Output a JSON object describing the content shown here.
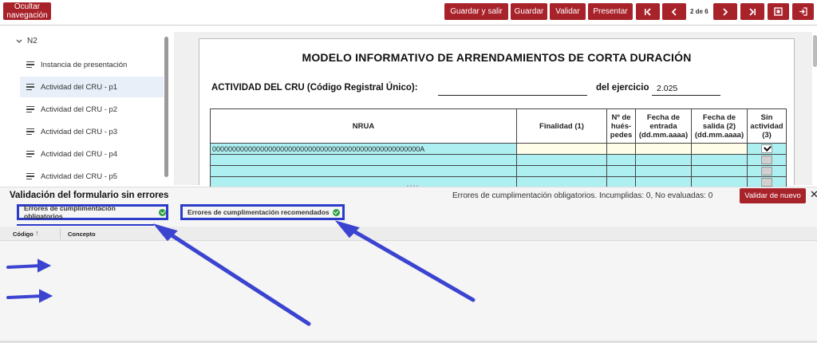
{
  "nav_toggle": {
    "label": "Ocultar navegación"
  },
  "toolbar": {
    "guardar_salir": "Guardar y salir",
    "guardar": "Guardar",
    "validar": "Validar",
    "presentar": "Presentar",
    "first_icon": "first-page-icon",
    "prev_icon": "previous-page-icon",
    "page_indicator": "2 de 6",
    "next_icon": "next-page-icon",
    "last_icon": "last-page-icon",
    "fit_icon": "fit-screen-icon",
    "exit_icon": "exit-icon"
  },
  "sidebar": {
    "root": "N2",
    "items": [
      {
        "label": "Instancia de presentación"
      },
      {
        "label": "Actividad del CRU - p1"
      },
      {
        "label": "Actividad del CRU - p2"
      },
      {
        "label": "Actividad del CRU - p3"
      },
      {
        "label": "Actividad del CRU - p4"
      },
      {
        "label": "Actividad del CRU - p5"
      }
    ],
    "active_index": 1
  },
  "document": {
    "title": "MODELO INFORMATIVO DE ARRENDAMIENTOS DE CORTA DURACIÓN",
    "cru_label": "ACTIVIDAD DEL CRU (Código Registral Único):",
    "ejercicio_label": "del ejercicio",
    "ejercicio_value": "2.025",
    "table": {
      "headers": {
        "nrua": "NRUA",
        "finalidad": "Finalidad (1)",
        "huespedes": "Nº de hués-pedes",
        "fecha_entrada": "Fecha de entrada (dd.mm.aaaa)",
        "fecha_salida": "Fecha de salida (2) (dd.mm.aaaa)",
        "sin_actividad": "Sin actividad (3)"
      },
      "rows": [
        {
          "nrua": "0000000000000000000000000000000000000000000000000000A",
          "sin_actividad": true
        },
        {
          "nrua": "",
          "sin_actividad": false
        },
        {
          "nrua": "",
          "sin_actividad": false
        },
        {
          "nrua": "",
          "sin_actividad": false
        }
      ]
    }
  },
  "validation": {
    "title": "Validación del formulario sin errores",
    "status": "Errores de cumplimentación obligatorios. Incumplidas: 0, No evaluadas: 0",
    "revalidate": "Validar de nuevo",
    "close": "✕",
    "tabs": [
      {
        "label": "Errores de cumplimentación obligatorios",
        "status": "ok"
      },
      {
        "label": "Errores de cumplimentación recomendados",
        "status": "ok"
      }
    ],
    "columns": {
      "codigo": "Código",
      "sort_glyph": "↑",
      "concepto": "Concepto"
    }
  },
  "annotation_color": "#3b44d0",
  "accent_red": "#a8222a"
}
